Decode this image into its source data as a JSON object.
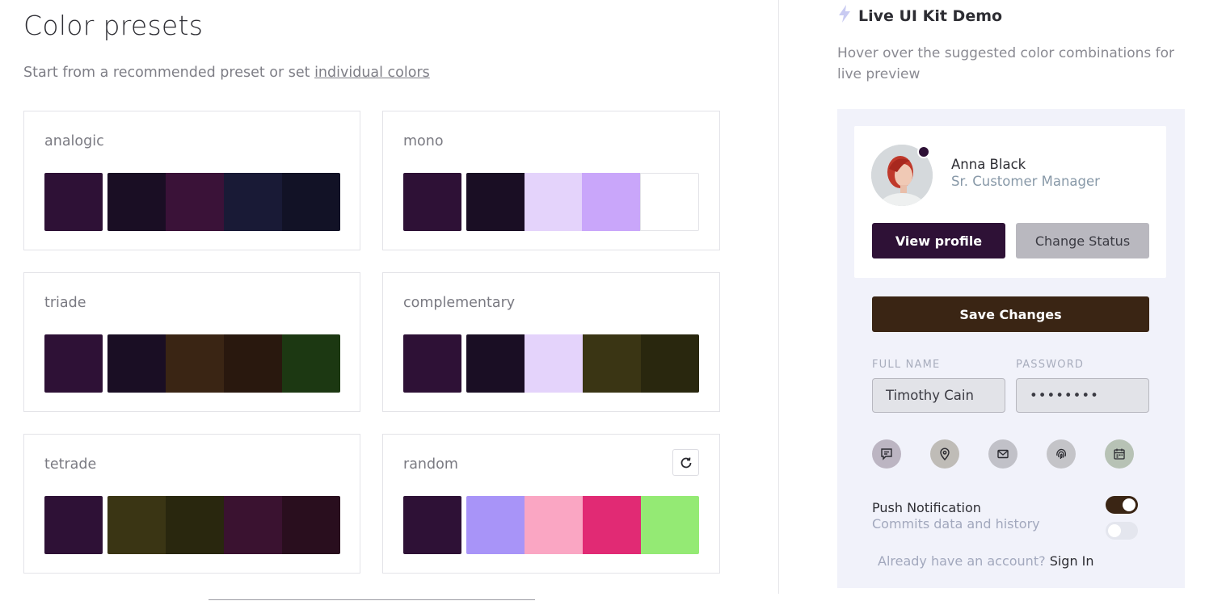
{
  "header": {
    "title": "Color presets",
    "subtitle_text": "Start from a recommended preset or set ",
    "subtitle_link": "individual colors"
  },
  "presets": [
    {
      "name": "analogic",
      "swatches": [
        "#2e1136",
        "#1a0e24",
        "#3a1238",
        "#191a36",
        "#121226"
      ]
    },
    {
      "name": "mono",
      "swatches": [
        "#2e1136",
        "#1a0e24",
        "#e4d3fb",
        "#c9a6fa",
        "#ffffff"
      ]
    },
    {
      "name": "triade",
      "swatches": [
        "#2e1136",
        "#1a0e24",
        "#3a2514",
        "#29180e",
        "#1c3812"
      ]
    },
    {
      "name": "complementary",
      "swatches": [
        "#2e1136",
        "#1a0e24",
        "#e4d3fb",
        "#3a3514",
        "#29270e"
      ]
    },
    {
      "name": "tetrade",
      "swatches": [
        "#2e1136",
        "#3a3514",
        "#29270e",
        "#3a1230",
        "#290e1e"
      ]
    },
    {
      "name": "random",
      "swatches": [
        "#2e1136",
        "#a894f8",
        "#faa6c3",
        "#e12a74",
        "#94ea74"
      ],
      "refresh_icon": "refresh-icon"
    }
  ],
  "demo": {
    "title": "Live UI Kit Demo",
    "title_icon": "lightning-icon",
    "description": "Hover over the suggested color combinations for live preview",
    "profile": {
      "name": "Anna Black",
      "role": "Sr. Customer Manager",
      "view_label": "View profile",
      "status_label": "Change Status"
    },
    "save_label": "Save Changes",
    "form": {
      "full_name_label": "FULL NAME",
      "full_name_value": "Timothy Cain",
      "password_label": "PASSWORD",
      "password_value": "••••••••"
    },
    "icons": [
      {
        "name": "message-icon",
        "bg": "#bcb5c2"
      },
      {
        "name": "location-pin-icon",
        "bg": "#bfbcb7"
      },
      {
        "name": "mail-icon",
        "bg": "#c1c1c8"
      },
      {
        "name": "fingerprint-icon",
        "bg": "#c4c4c8"
      },
      {
        "name": "calendar-icon",
        "bg": "#b7c2b5"
      }
    ],
    "push_title": "Push Notification",
    "push_subtitle": "Commits data and history",
    "toggle_on": true,
    "toggle2_on": false,
    "account_text": "Already have an account?",
    "signin_label": "Sign In"
  },
  "colors": {
    "primary": "#2e1136",
    "save": "#3a2514",
    "panel_bg": "#f1f2fa"
  }
}
